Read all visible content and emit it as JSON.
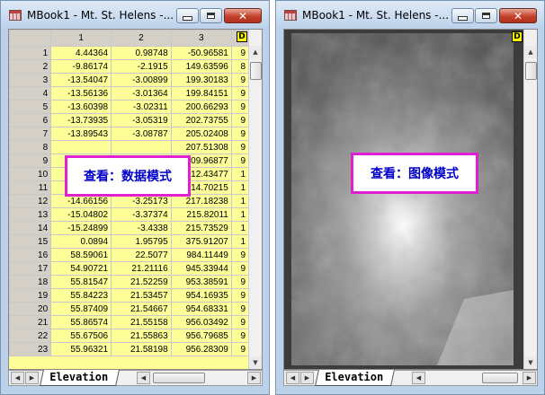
{
  "left_window": {
    "title": "MBook1 - Mt. St. Helens -...",
    "overlay_label": "查看：数据模式",
    "column_headers": [
      "1",
      "2",
      "3"
    ],
    "rows": [
      {
        "n": "1",
        "c1": "4.44364",
        "c2": "0.98748",
        "c3": "-50.96581",
        "c4": "9"
      },
      {
        "n": "2",
        "c1": "-9.86174",
        "c2": "-2.1915",
        "c3": "149.63596",
        "c4": "8"
      },
      {
        "n": "3",
        "c1": "-13.54047",
        "c2": "-3.00899",
        "c3": "199.30183",
        "c4": "9"
      },
      {
        "n": "4",
        "c1": "-13.56136",
        "c2": "-3.01364",
        "c3": "199.84151",
        "c4": "9"
      },
      {
        "n": "5",
        "c1": "-13.60398",
        "c2": "-3.02311",
        "c3": "200.66293",
        "c4": "9"
      },
      {
        "n": "6",
        "c1": "-13.73935",
        "c2": "-3.05319",
        "c3": "202.73755",
        "c4": "9"
      },
      {
        "n": "7",
        "c1": "-13.89543",
        "c2": "-3.08787",
        "c3": "205.02408",
        "c4": "9"
      },
      {
        "n": "8",
        "c1": "",
        "c2": "",
        "c3": "207.51308",
        "c4": "9"
      },
      {
        "n": "9",
        "c1": "",
        "c2": "",
        "c3": "209.96877",
        "c4": "9"
      },
      {
        "n": "10",
        "c1": "",
        "c2": "",
        "c3": "212.43477",
        "c4": "1"
      },
      {
        "n": "11",
        "c1": "",
        "c2": "",
        "c3": "214.70215",
        "c4": "1"
      },
      {
        "n": "12",
        "c1": "-14.66156",
        "c2": "-3.25173",
        "c3": "217.18238",
        "c4": "1"
      },
      {
        "n": "13",
        "c1": "-15.04802",
        "c2": "-3.37374",
        "c3": "215.82011",
        "c4": "1"
      },
      {
        "n": "14",
        "c1": "-15.24899",
        "c2": "-3.4338",
        "c3": "215.73529",
        "c4": "1"
      },
      {
        "n": "15",
        "c1": "0.0894",
        "c2": "1.95795",
        "c3": "375.91207",
        "c4": "1"
      },
      {
        "n": "16",
        "c1": "58.59061",
        "c2": "22.5077",
        "c3": "984.11449",
        "c4": "9"
      },
      {
        "n": "17",
        "c1": "54.90721",
        "c2": "21.21116",
        "c3": "945.33944",
        "c4": "9"
      },
      {
        "n": "18",
        "c1": "55.81547",
        "c2": "21.52259",
        "c3": "953.38591",
        "c4": "9"
      },
      {
        "n": "19",
        "c1": "55.84223",
        "c2": "21.53457",
        "c3": "954.16935",
        "c4": "9"
      },
      {
        "n": "20",
        "c1": "55.87409",
        "c2": "21.54667",
        "c3": "954.68331",
        "c4": "9"
      },
      {
        "n": "21",
        "c1": "55.86574",
        "c2": "21.55158",
        "c3": "956.03492",
        "c4": "9"
      },
      {
        "n": "22",
        "c1": "55.67506",
        "c2": "21.55863",
        "c3": "956.79685",
        "c4": "9"
      },
      {
        "n": "23",
        "c1": "55.96321",
        "c2": "21.58198",
        "c3": "956.28309",
        "c4": "9"
      }
    ],
    "sheet_tab": "Elevation"
  },
  "right_window": {
    "title": "MBook1 - Mt. St. Helens -...",
    "overlay_label": "查看：图像模式",
    "sheet_tab": "Elevation"
  },
  "badge_letter": "D",
  "colors": {
    "cell_fill": "#ffff99",
    "header_fill": "#d4d0c8",
    "overlay_border": "#e020d0",
    "overlay_text": "#0000c8",
    "close_button": "#c4412b"
  }
}
